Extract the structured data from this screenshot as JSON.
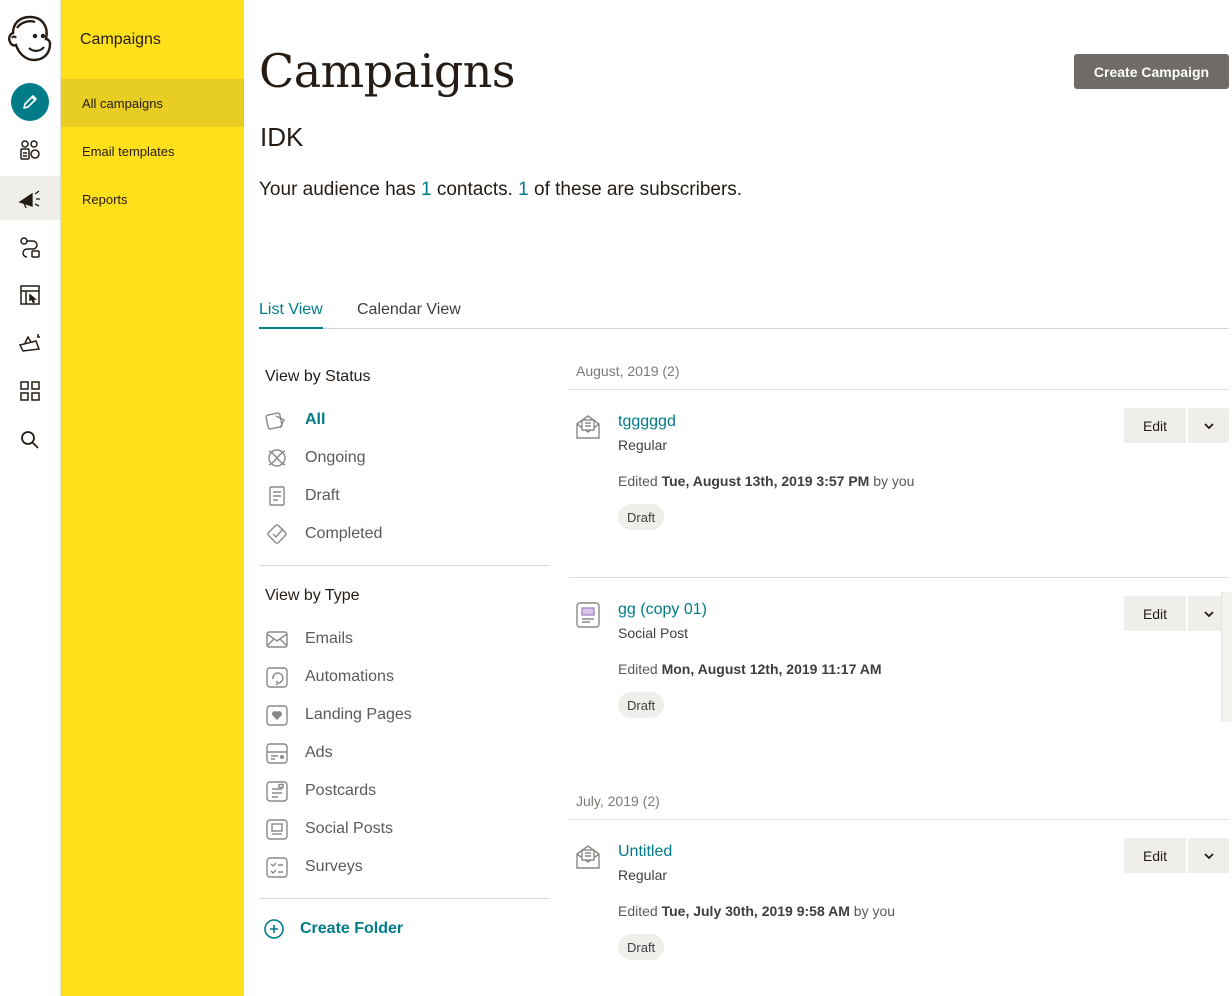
{
  "sidebar": {
    "title": "Campaigns",
    "items": [
      {
        "label": "All campaigns"
      },
      {
        "label": "Email templates"
      },
      {
        "label": "Reports"
      }
    ]
  },
  "rail": {
    "icons": [
      "mailchimp-logo",
      "create-pencil-icon",
      "audience-icon",
      "campaigns-megaphone-icon",
      "automations-icon",
      "website-icon",
      "content-studio-icon",
      "integrations-grid-icon",
      "search-icon"
    ]
  },
  "header": {
    "title": "Campaigns",
    "create_button": "Create Campaign"
  },
  "audience": {
    "name": "IDK",
    "summary_prefix": "Your audience has ",
    "contacts_count": "1",
    "summary_middle": " contacts. ",
    "subscribers_count": "1",
    "summary_suffix": " of these are subscribers."
  },
  "tabs": [
    {
      "label": "List View",
      "active": true
    },
    {
      "label": "Calendar View",
      "active": false
    }
  ],
  "filters": {
    "status_heading": "View by Status",
    "status": [
      {
        "label": "All",
        "icon": "all-icon",
        "active": true
      },
      {
        "label": "Ongoing",
        "icon": "ongoing-icon"
      },
      {
        "label": "Draft",
        "icon": "draft-icon"
      },
      {
        "label": "Completed",
        "icon": "completed-icon"
      }
    ],
    "type_heading": "View by Type",
    "types": [
      {
        "label": "Emails",
        "icon": "email-icon"
      },
      {
        "label": "Automations",
        "icon": "automation-icon"
      },
      {
        "label": "Landing Pages",
        "icon": "landing-page-icon"
      },
      {
        "label": "Ads",
        "icon": "ads-icon"
      },
      {
        "label": "Postcards",
        "icon": "postcard-icon"
      },
      {
        "label": "Social Posts",
        "icon": "social-post-icon"
      },
      {
        "label": "Surveys",
        "icon": "survey-icon"
      }
    ],
    "create_folder": "Create Folder"
  },
  "groups": [
    {
      "label": "August, 2019 (2)",
      "campaigns": [
        {
          "name": "tgggggd",
          "type": "Regular",
          "edited_prefix": "Edited ",
          "edited_date": "Tue, August 13th, 2019 3:57 PM",
          "edited_suffix": " by you",
          "status": "Draft",
          "icon": "email-campaign-icon",
          "edit_label": "Edit"
        },
        {
          "name": "gg (copy 01)",
          "type": "Social Post",
          "edited_prefix": "Edited ",
          "edited_date": "Mon, August 12th, 2019 11:17 AM",
          "edited_suffix": "",
          "status": "Draft",
          "icon": "social-post-campaign-icon",
          "edit_label": "Edit"
        }
      ]
    },
    {
      "label": "July, 2019 (2)",
      "campaigns": [
        {
          "name": "Untitled",
          "type": "Regular",
          "edited_prefix": "Edited ",
          "edited_date": "Tue, July 30th, 2019 9:58 AM",
          "edited_suffix": " by you",
          "status": "Draft",
          "icon": "email-campaign-icon",
          "edit_label": "Edit"
        }
      ]
    }
  ],
  "colors": {
    "brand_yellow": "#ffe01b",
    "accent_teal": "#007c89",
    "button_gray": "#6f6b66"
  }
}
